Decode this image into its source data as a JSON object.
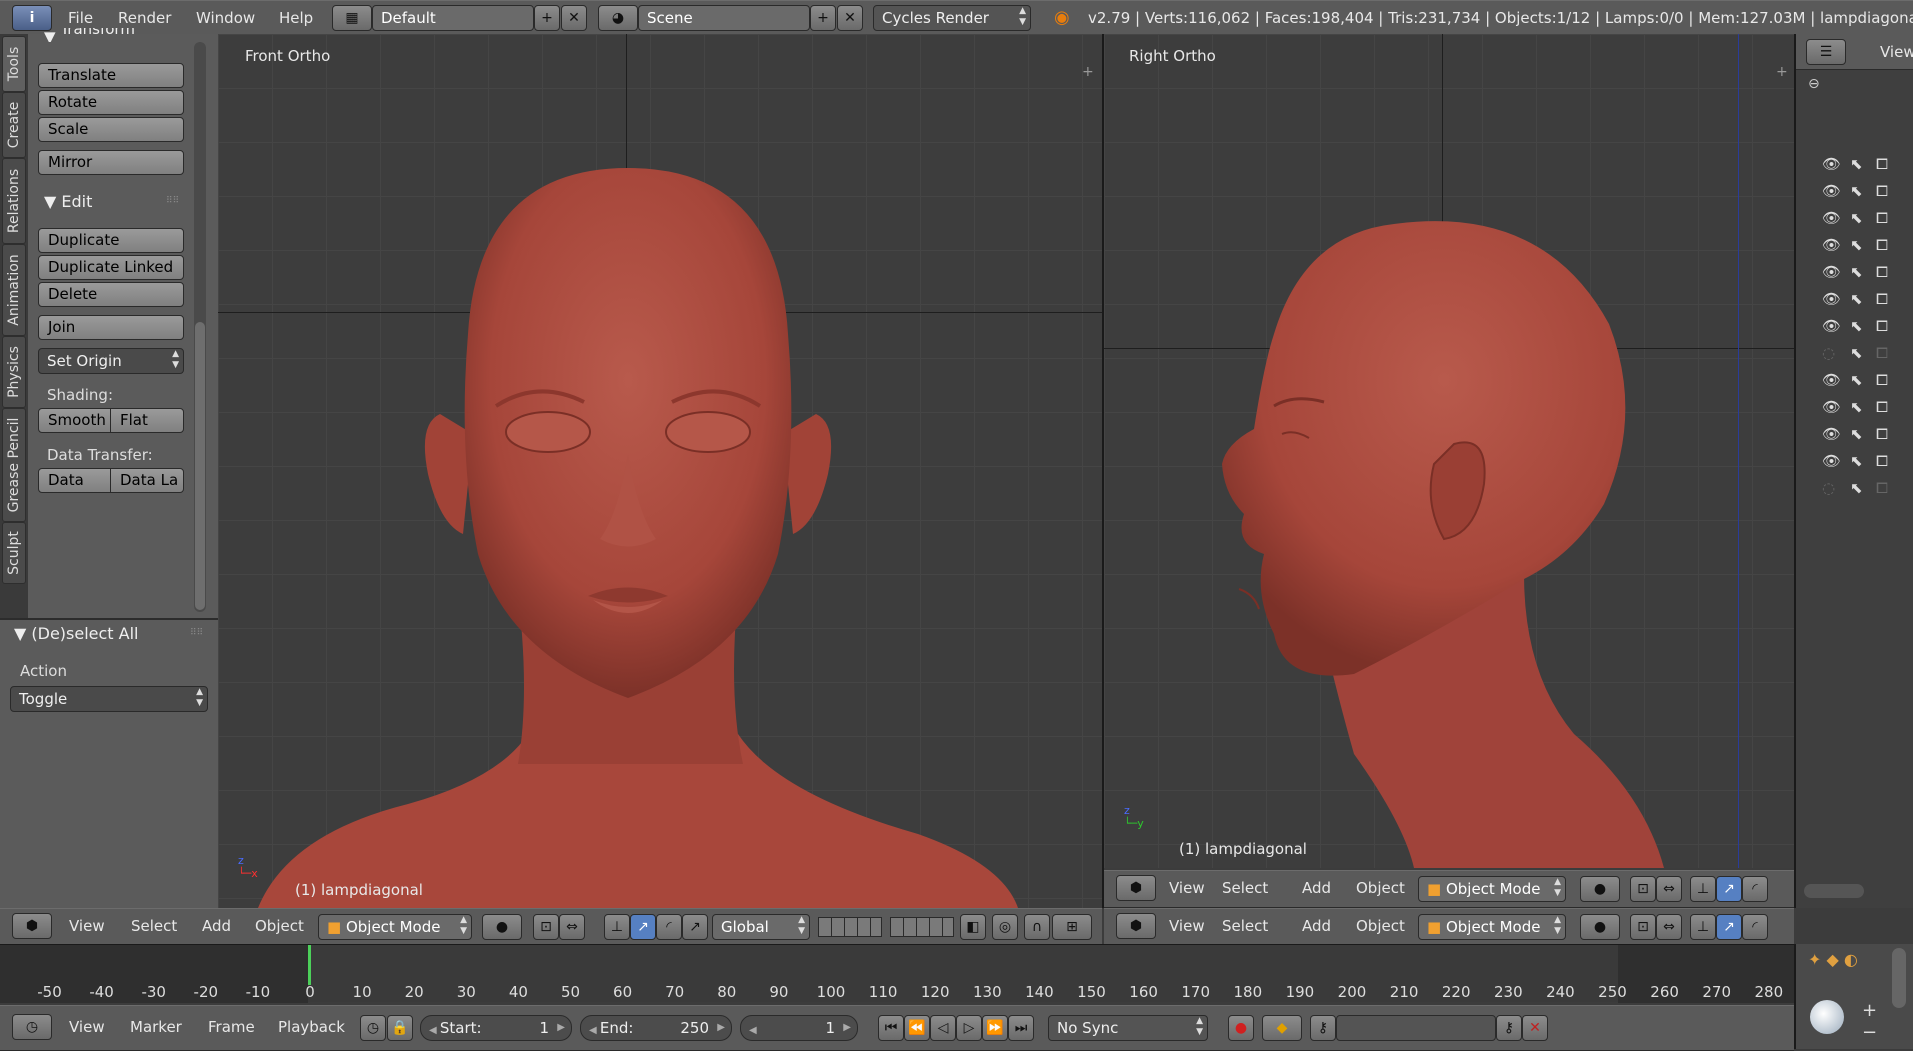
{
  "top_bar": {
    "menus": [
      "File",
      "Render",
      "Window",
      "Help"
    ],
    "layout": "Default",
    "scene": "Scene",
    "engine": "Cycles Render",
    "stats": "v2.79 | Verts:116,062 | Faces:198,404 | Tris:231,734 | Objects:1/12 | Lamps:0/0 | Mem:127.03M | lampdiagonal"
  },
  "tool_tabs": [
    "Tools",
    "Create",
    "Relations",
    "Animation",
    "Physics",
    "Grease Pencil",
    "Sculpt"
  ],
  "tool_panel": {
    "transform_header": "Transform",
    "transform_buttons": [
      "Translate",
      "Rotate",
      "Scale"
    ],
    "mirror": "Mirror",
    "edit_header": "Edit",
    "edit_buttons": [
      "Duplicate",
      "Duplicate Linked",
      "Delete"
    ],
    "join": "Join",
    "set_origin": "Set Origin",
    "shading_label": "Shading:",
    "smooth": "Smooth",
    "flat": "Flat",
    "data_transfer_label": "Data Transfer:",
    "data": "Data",
    "data_la": "Data La"
  },
  "operator_panel": {
    "header": "(De)select All",
    "action_label": "Action",
    "action_value": "Toggle"
  },
  "viewport_left": {
    "title": "Front Ortho",
    "object_label": "(1) lampdiagonal"
  },
  "viewport_right": {
    "title": "Right Ortho",
    "object_label": "(1) lampdiagonal"
  },
  "view_header": {
    "menus": [
      "View",
      "Select",
      "Add",
      "Object"
    ],
    "mode": "Object Mode",
    "orientation": "Global"
  },
  "outliner": {
    "view_label": "View",
    "rows": 13
  },
  "timeline": {
    "ticks": [
      "-50",
      "-40",
      "-30",
      "-20",
      "-10",
      "0",
      "10",
      "20",
      "30",
      "40",
      "50",
      "60",
      "70",
      "80",
      "90",
      "100",
      "110",
      "120",
      "130",
      "140",
      "150",
      "160",
      "170",
      "180",
      "190",
      "200",
      "210",
      "220",
      "230",
      "240",
      "250",
      "260",
      "270",
      "280"
    ],
    "menus": [
      "View",
      "Marker",
      "Frame",
      "Playback"
    ],
    "start_label": "Start:",
    "start_value": "1",
    "end_label": "End:",
    "end_value": "250",
    "current_frame": "1",
    "sync": "No Sync"
  },
  "colors": {
    "skin": "#a6463a",
    "background": "#3d3d3d",
    "header": "#5a5a5a",
    "panel": "#5b5b5b",
    "active_blue": "#5680c2"
  }
}
